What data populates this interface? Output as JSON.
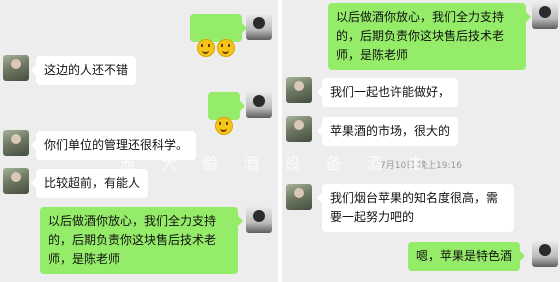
{
  "left_panel": {
    "messages": [
      {
        "sender": "me",
        "emoji": [
          "grin-emoji",
          "grin-emoji"
        ]
      },
      {
        "sender": "other",
        "text": "这边的人还不错"
      },
      {
        "sender": "me",
        "emoji": [
          "smile-emoji"
        ]
      },
      {
        "sender": "other",
        "text": "你们单位的管理还很科学。"
      },
      {
        "sender": "other",
        "text": "比较超前，有能人"
      },
      {
        "sender": "me",
        "text": "以后做酒你放心，我们全力支持\n的，后期负责你这块售后技术老\n师，是陈老师"
      }
    ]
  },
  "right_panel": {
    "messages": [
      {
        "sender": "me",
        "text": "以后做酒你放心，我们全力支持\n的，后期负责你这块售后技术老\n师，是陈老师"
      },
      {
        "sender": "other",
        "text": "我们一起也许能做好，"
      },
      {
        "sender": "other",
        "text": "苹果酒的市场，很大的"
      },
      {
        "sender": "other",
        "text": "我们烟台苹果的知名度很高，需\n要一起努力吧的"
      },
      {
        "sender": "me",
        "text": "嗯，苹果是特色酒"
      }
    ],
    "timestamp": "7月10日 晚上19:16"
  },
  "watermark": "雅 大 酿 酒 设 备 酒 由"
}
